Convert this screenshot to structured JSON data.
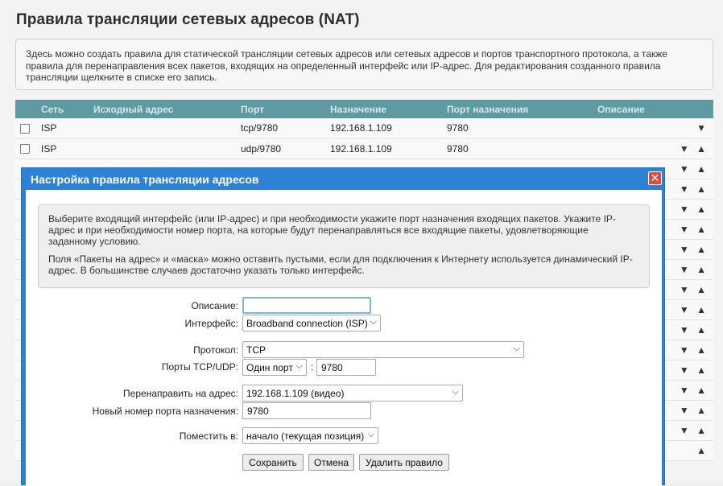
{
  "page": {
    "title": "Правила трансляции сетевых адресов (NAT)",
    "info": "Здесь можно создать правила для статической трансляции сетевых адресов или сетевых адресов и портов транспортного протокола, а также правила для перенаправления всех пакетов, входящих на определенный интерфейс или IP-адрес. Для редактирования созданного правила трансляции щелкните в списке его запись."
  },
  "table": {
    "headers": [
      "Сеть",
      "Исходный адрес",
      "Порт",
      "Назначение",
      "Порт назначения",
      "Описание"
    ],
    "rows": [
      {
        "network": "ISP",
        "source": "",
        "port": "tcp/9780",
        "destination": "192.168.1.109",
        "dest_port": "9780",
        "description": "",
        "arrows": "▼"
      },
      {
        "network": "ISP",
        "source": "",
        "port": "udp/9780",
        "destination": "192.168.1.109",
        "dest_port": "9780",
        "description": "",
        "arrows": "▼ ▲"
      }
    ],
    "hidden_row_arrows": "▼ ▲",
    "last_row_arrows": "▲"
  },
  "dialog": {
    "title": "Настройка правила трансляции адресов",
    "close_glyph": "✕",
    "info_p1": "Выберите входящий интерфейс (или IP-адрес) и при необходимости укажите порт назначения входящих пакетов. Укажите IP-адрес и при необходимости номер порта, на которые будут перенаправляться все входящие пакеты, удовлетворяющие заданному условию.",
    "info_p2": "Поля «Пакеты на адрес» и «маска» можно оставить пустыми, если для подключения к Интернету используется динамический IP-адрес. В большинстве случаев достаточно указать только интерфейс.",
    "form": {
      "description_label": "Описание:",
      "description_value": "",
      "interface_label": "Интерфейс:",
      "interface_value": "Broadband connection (ISP)",
      "protocol_label": "Протокол:",
      "protocol_value": "TCP",
      "ports_label": "Порты TCP/UDP:",
      "ports_mode_value": "Один порт",
      "ports_separator": ":",
      "port_value": "9780",
      "redirect_label": "Перенаправить на адрес:",
      "redirect_value": "192.168.1.109 (видео)",
      "new_port_label": "Новый номер порта назначения:",
      "new_port_value": "9780",
      "place_label": "Поместить в:",
      "place_value": "начало (текущая позиция)"
    },
    "buttons": {
      "save": "Сохранить",
      "cancel": "Отмена",
      "delete": "Удалить правило"
    }
  },
  "icons": {
    "chevron_down": "⌵",
    "arrow_down": "▼",
    "arrow_up": "▲"
  },
  "colors": {
    "table_header": "#5e9aa1",
    "dialog_frame": "#2e82d6",
    "close_button": "#e04a3a"
  }
}
